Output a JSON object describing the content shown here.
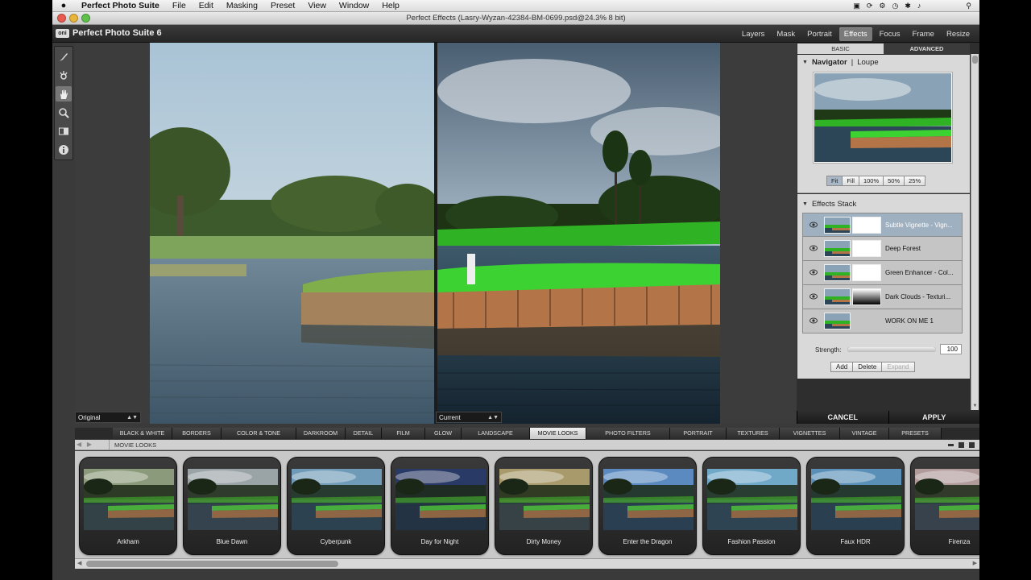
{
  "menubar": {
    "app_name": "Perfect Photo Suite",
    "items": [
      "File",
      "Edit",
      "Masking",
      "Preset",
      "View",
      "Window",
      "Help"
    ]
  },
  "window": {
    "title": "Perfect Effects (Lasry-Wyzan-42384-BM-0699.psd@24.3% 8 bit)"
  },
  "app": {
    "logo_mark": "oni",
    "name": "Perfect Photo Suite 6",
    "modules": [
      "Layers",
      "Mask",
      "Portrait",
      "Effects",
      "Focus",
      "Frame",
      "Resize"
    ],
    "active_module": "Effects"
  },
  "tools": [
    "brush-icon",
    "masking-bug-icon",
    "hand-icon",
    "zoom-icon",
    "compare-icon",
    "info-icon"
  ],
  "canvas": {
    "left_view": "Original",
    "right_view": "Current"
  },
  "right_panel": {
    "tabs": [
      "BASIC",
      "ADVANCED"
    ],
    "navigator": {
      "title": "Navigator",
      "alt": "Loupe",
      "zoom_buttons": [
        "Fit",
        "Fill",
        "100%",
        "50%",
        "25%"
      ]
    },
    "effects_stack": {
      "title": "Effects Stack",
      "layers": [
        {
          "name": "Subtle Vignette - Vign...",
          "selected": true,
          "mask": "white"
        },
        {
          "name": "Deep Forest",
          "selected": false,
          "mask": "white"
        },
        {
          "name": "Green Enhancer - Col...",
          "selected": false,
          "mask": "white"
        },
        {
          "name": "Dark Clouds - Texturi...",
          "selected": false,
          "mask": "gradient"
        },
        {
          "name": "WORK ON ME 1",
          "selected": false,
          "mask": "none"
        }
      ],
      "strength_label": "Strength:",
      "strength_value": "100",
      "strength_fraction": 1.0,
      "buttons": [
        "Add",
        "Delete",
        "Expand"
      ]
    },
    "cancel": "CANCEL",
    "apply": "APPLY"
  },
  "categories": {
    "items": [
      "BLACK & WHITE",
      "BORDERS",
      "COLOR & TONE",
      "DARKROOM",
      "DETAIL",
      "FILM",
      "GLOW",
      "LANDSCAPE",
      "MOVIE LOOKS",
      "PHOTO FILTERS",
      "PORTRAIT",
      "TEXTURES",
      "VIGNETTES",
      "VINTAGE",
      "PRESETS"
    ],
    "active": "MOVIE LOOKS",
    "current_label": "MOVIE LOOKS"
  },
  "presets": [
    {
      "name": "Arkham",
      "tint": "#8a9a7a"
    },
    {
      "name": "Blue Dawn",
      "tint": "#9aa3a6"
    },
    {
      "name": "Cyberpunk",
      "tint": "#6f9bb8"
    },
    {
      "name": "Day for Night",
      "tint": "#2a3a66"
    },
    {
      "name": "Dirty Money",
      "tint": "#a89a6a"
    },
    {
      "name": "Enter the Dragon",
      "tint": "#5a8ac0"
    },
    {
      "name": "Fashion Passion",
      "tint": "#70a8c8"
    },
    {
      "name": "Faux HDR",
      "tint": "#5a90b8"
    },
    {
      "name": "Firenza",
      "tint": "#b09a9a"
    }
  ]
}
